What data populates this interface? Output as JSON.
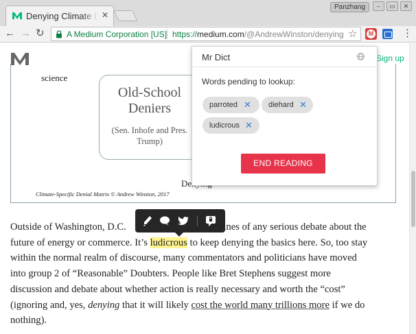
{
  "browser": {
    "tab": {
      "title": "Denying Climate Denial",
      "close_glyph": "✕"
    },
    "profile_name": "Panzhang",
    "window_controls": {
      "minimize": "–",
      "maximize": "▭",
      "close": "✕"
    },
    "address": {
      "secure_label": "A Medium Corporation [US]",
      "url_scheme": "https://",
      "url_host": "medium.com",
      "url_path": "/@AndrewWinston/denying-climate-denial"
    },
    "extension_badge": "M"
  },
  "site": {
    "signup_label": "Sign up"
  },
  "figure": {
    "science_text": "science",
    "box_title": "Old-School Deniers",
    "box_subtitle": "(Sen. Inhofe and Pres. Trump)",
    "partial_text": "Denying",
    "caption": "Climate-Specific Denial Matrix © Andrew Winston, 2017"
  },
  "article": {
    "l1_a": "Outside of Washington, D.C.",
    "l1_b": "elines of any serious debate about the",
    "l2_a": "future of energy or commerce. It’s ",
    "l2_hl": "ludicrous",
    "l2_b": " to keep denying the basics here. So, too stay",
    "l3": "within the normal realm of discourse, many commentators and politicians have moved",
    "l4": "into group 2 of “Reasonable” Doubters. People like Bret Stephens suggest more",
    "l5": "discussion and debate about whether action is really necessary and worth the “cost”",
    "l6_a": "(ignoring and, yes, ",
    "l6_em": "denying",
    "l6_b": " that it will likely ",
    "l6_link": "cost the world many trillions more",
    "l6_c": " if we do",
    "l7": "nothing)."
  },
  "highlight_menu": {
    "icons": [
      "highlighter-icon",
      "comment-icon",
      "twitter-icon",
      "private-note-icon"
    ]
  },
  "popup": {
    "title": "Mr Dict",
    "pending_label": "Words pending to lookup:",
    "words": [
      "parroted",
      "diehard",
      "ludicrous"
    ],
    "remove_glyph": "✕",
    "end_button": "END READING"
  },
  "colors": {
    "accent_red": "#e8344b",
    "highlight_yellow": "#fff48f",
    "secure_green": "#0b8043",
    "medium_green": "#02b875",
    "chip_x_blue": "#3a7bd5"
  }
}
